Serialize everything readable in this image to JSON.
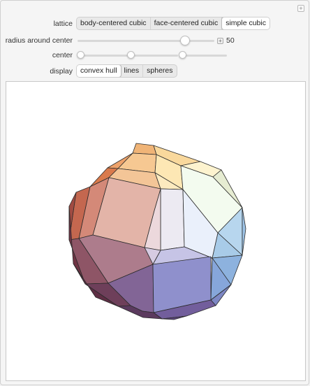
{
  "controls": {
    "lattice": {
      "label": "lattice",
      "options": [
        "body-centered cubic",
        "face-centered cubic",
        "simple cubic"
      ],
      "selected": "simple cubic"
    },
    "radius": {
      "label": "radius around center",
      "value": "50",
      "fraction": 0.79
    },
    "center": {
      "label": "center",
      "values": [
        0.0,
        0.38,
        0.72
      ]
    },
    "display": {
      "label": "display",
      "options": [
        "convex hull",
        "lines",
        "spheres"
      ],
      "selected": "convex hull"
    }
  },
  "plot": {
    "shape": "convex hull polyhedron"
  }
}
